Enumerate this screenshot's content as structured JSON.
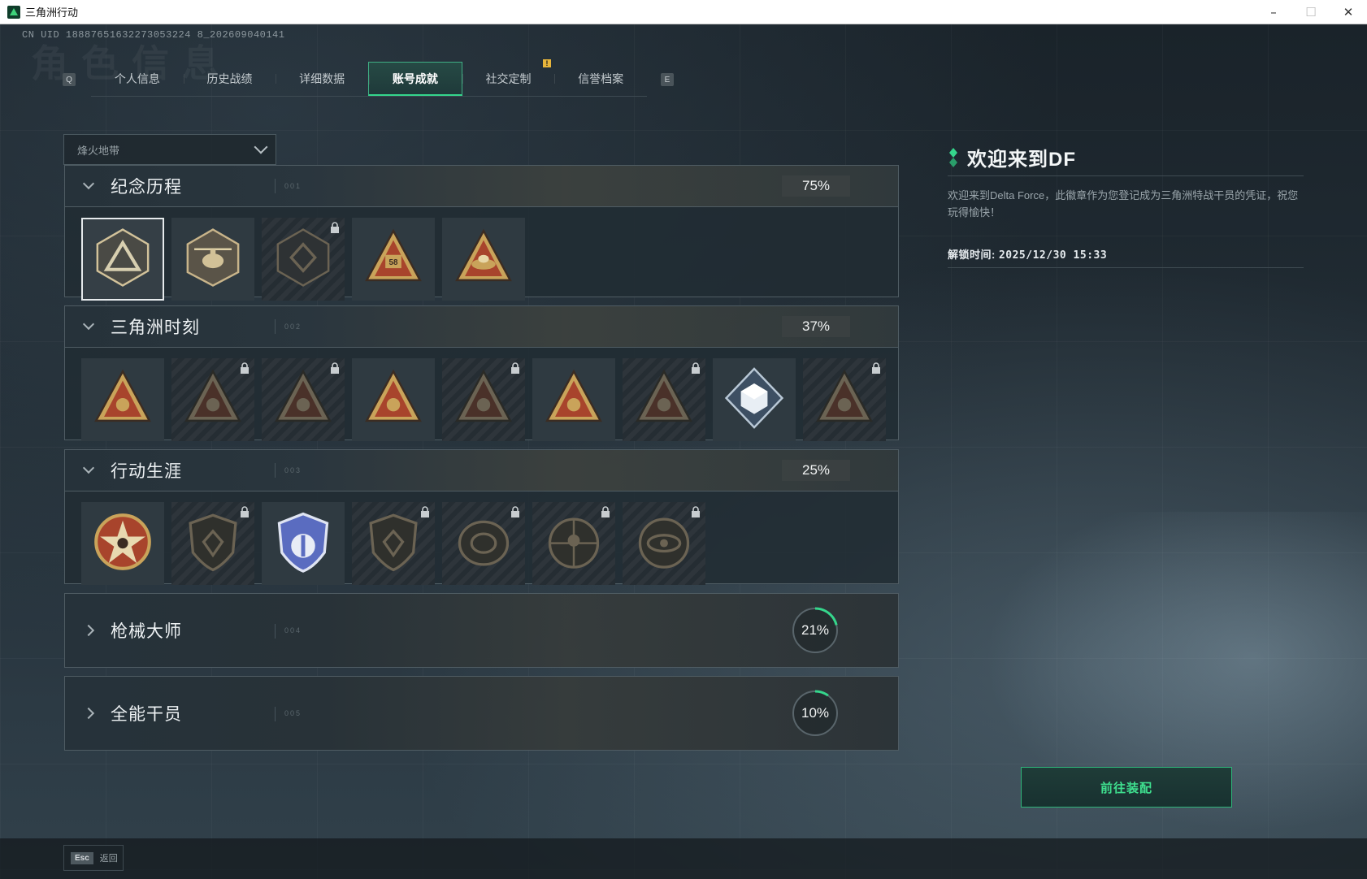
{
  "window": {
    "title": "三角洲行动",
    "controls": {
      "minimize": "–",
      "maximize": "☐",
      "close": "✕"
    }
  },
  "uid": "CN UID 18887651632273053224 8_202609040141",
  "watermark": "角色信息",
  "tabs": {
    "key_left": "Q",
    "key_right": "E",
    "notice": "!",
    "items": [
      {
        "label": "个人信息"
      },
      {
        "label": "历史战绩"
      },
      {
        "label": "详细数据"
      },
      {
        "label": "账号成就",
        "active": true
      },
      {
        "label": "社交定制"
      },
      {
        "label": "信誉档案"
      }
    ]
  },
  "mode_select": {
    "value": "烽火地带"
  },
  "sections": [
    {
      "title": "纪念历程",
      "deco": "001",
      "progress": "75%",
      "expanded": true,
      "badges": [
        {
          "icon": "delta-triangle-icon",
          "locked": false,
          "selected": true
        },
        {
          "icon": "helicopter-icon",
          "locked": false
        },
        {
          "icon": "shield-emblem-icon",
          "locked": true
        },
        {
          "icon": "triangle-58-icon",
          "locked": false
        },
        {
          "icon": "triangle-hands-icon",
          "locked": false
        }
      ]
    },
    {
      "title": "三角洲时刻",
      "deco": "002",
      "progress": "37%",
      "expanded": true,
      "badges": [
        {
          "icon": "triangle-box-icon",
          "locked": false
        },
        {
          "icon": "triangle-soldier-icon",
          "locked": true
        },
        {
          "icon": "triangle-star-icon",
          "locked": true
        },
        {
          "icon": "triangle-squad-icon",
          "locked": false
        },
        {
          "icon": "triangle-vehicle-icon",
          "locked": true
        },
        {
          "icon": "triangle-rocket-icon",
          "locked": false
        },
        {
          "icon": "triangle-fish-icon",
          "locked": true
        },
        {
          "icon": "diamond-cube-icon",
          "locked": false
        },
        {
          "icon": "triangle-dragon-icon",
          "locked": true
        }
      ]
    },
    {
      "title": "行动生涯",
      "deco": "003",
      "progress": "25%",
      "expanded": true,
      "badges": [
        {
          "icon": "star-medal-icon",
          "locked": false
        },
        {
          "icon": "flame-shield-icon",
          "locked": true
        },
        {
          "icon": "police-shield-icon",
          "locked": false
        },
        {
          "icon": "gem-shield-icon",
          "locked": true
        },
        {
          "icon": "oval-ring-icon",
          "locked": true
        },
        {
          "icon": "skull-compass-icon",
          "locked": true
        },
        {
          "icon": "eye-emblem-icon",
          "locked": true
        }
      ]
    },
    {
      "title": "枪械大师",
      "deco": "004",
      "progress": "21%",
      "progress_value": 0.21,
      "expanded": false
    },
    {
      "title": "全能干员",
      "deco": "005",
      "progress": "10%",
      "progress_value": 0.1,
      "expanded": false
    }
  ],
  "detail": {
    "title": "欢迎来到DF",
    "description": "欢迎来到Delta Force，此徽章作为您登记成为三角洲特战干员的凭证，祝您玩得愉快！",
    "unlock_label": "解锁时间: ",
    "unlock_time": "2025/12/30 15:33",
    "equip_button": "前往装配"
  },
  "footer": {
    "esc_key": "Esc",
    "back_label": "返回"
  },
  "colors": {
    "accent": "#35d68c",
    "badge_gold": "#c9a35a",
    "badge_red": "#a8442c"
  }
}
